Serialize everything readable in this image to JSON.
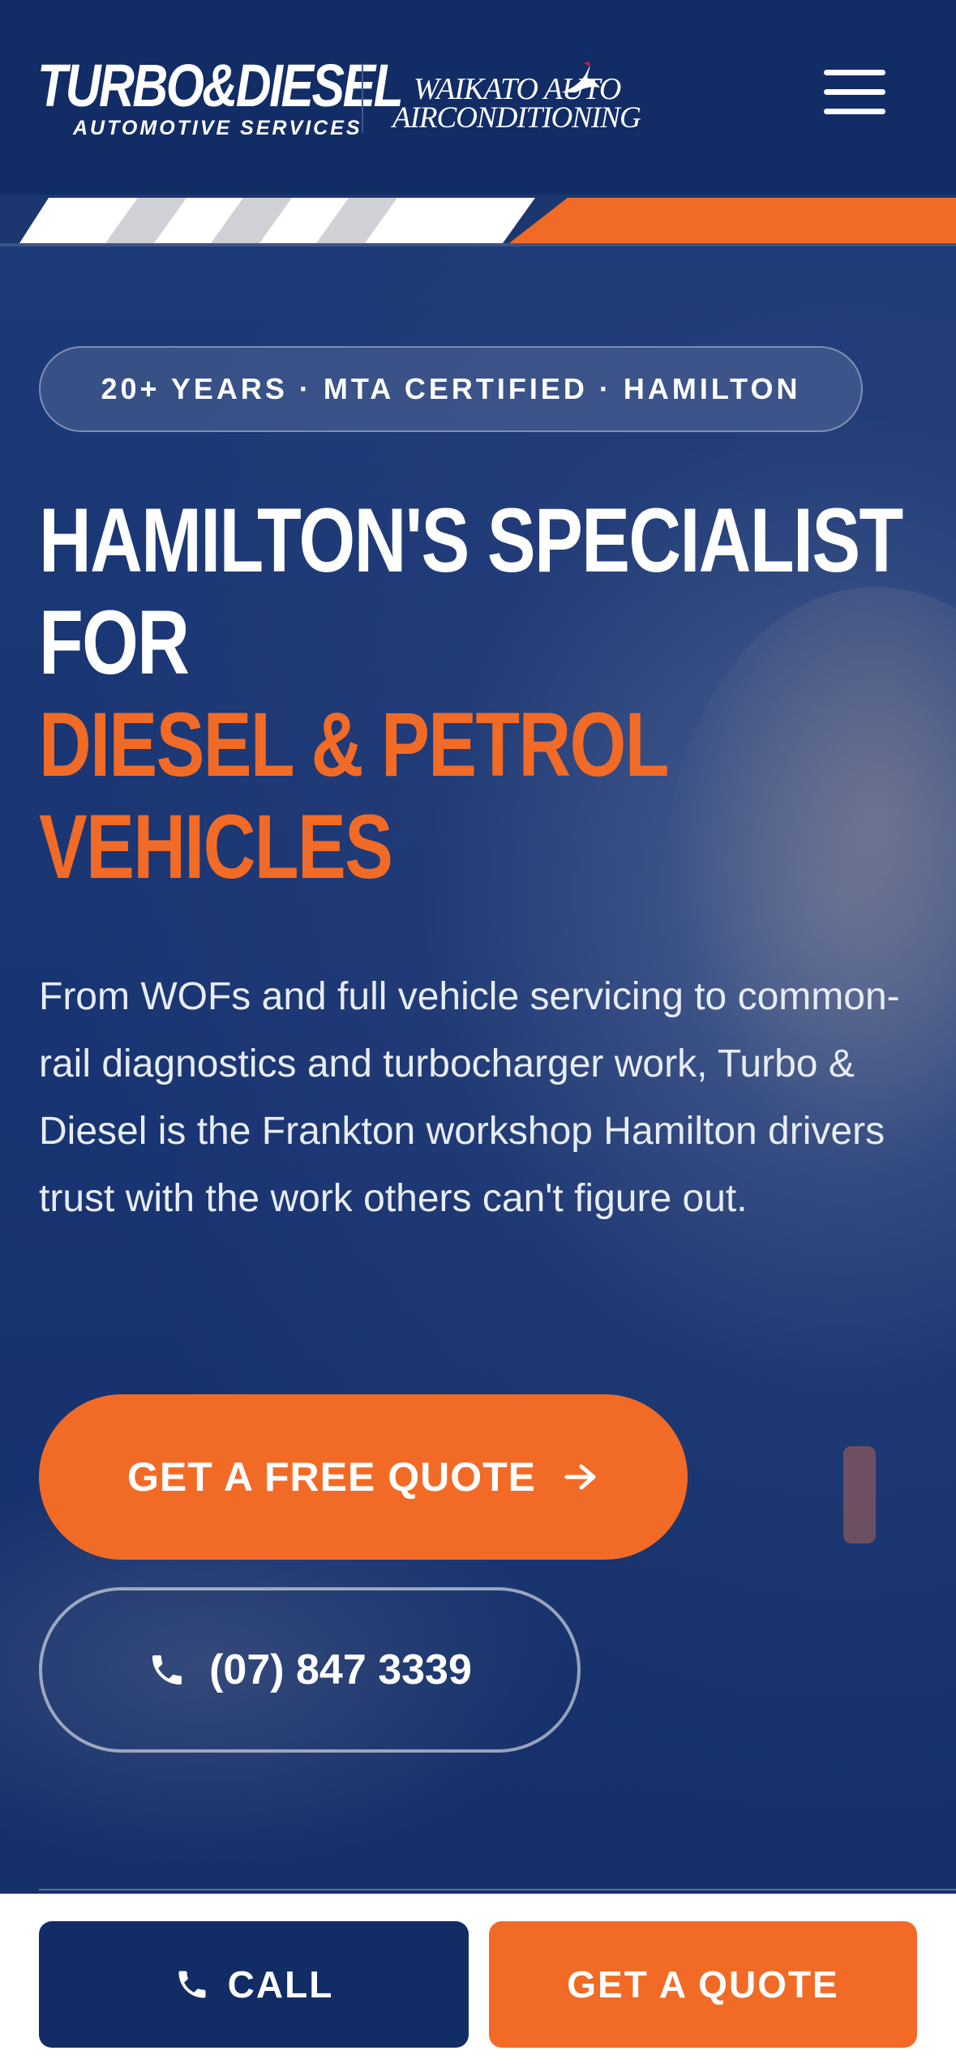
{
  "header": {
    "logo_primary": "TURBO&DIESEL",
    "logo_primary_sub": "AUTOMOTIVE SERVICES",
    "logo_secondary_line1": "WAIKATO AUTO",
    "logo_secondary_line2": "AIRCONDITIONING",
    "menu_icon": "hamburger-menu-icon"
  },
  "colors": {
    "navy": "#122c66",
    "orange": "#f26b26",
    "white": "#ffffff"
  },
  "hero": {
    "badge": "20+ YEARS · MTA CERTIFIED · HAMILTON",
    "headline_line1": "HAMILTON'S SPECIALIST",
    "headline_line2": "FOR",
    "headline_highlight_line1": "DIESEL & PETROL",
    "headline_highlight_line2": "VEHICLES",
    "intro": "From WOFs and full vehicle servicing to common-rail diagnostics and turbocharger work, Turbo & Diesel is the Frankton workshop Hamilton drivers trust with the work others can't figure out.",
    "primary_cta": "GET A FREE QUOTE",
    "primary_cta_icon": "arrow-right-icon",
    "phone_cta": "(07) 847 3339",
    "phone_icon": "phone-icon"
  },
  "bottom_bar": {
    "call_label": "CALL",
    "call_icon": "phone-icon",
    "quote_label": "GET A QUOTE"
  }
}
